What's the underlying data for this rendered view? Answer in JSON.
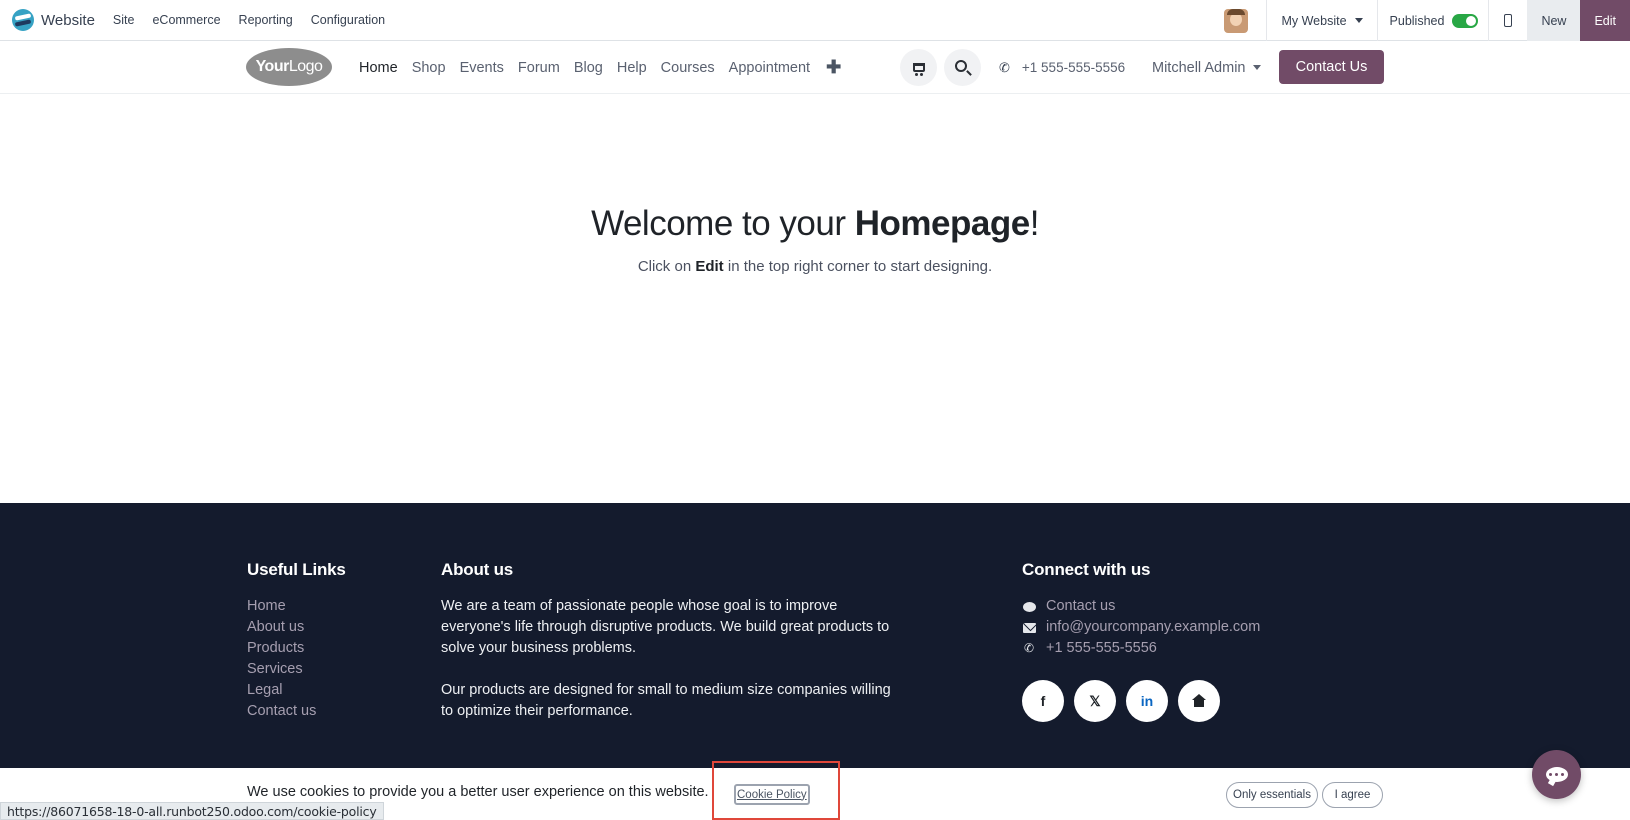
{
  "topbar": {
    "brand": "Website",
    "menu": [
      "Site",
      "eCommerce",
      "Reporting",
      "Configuration"
    ],
    "site_selector": "My Website",
    "published_label": "Published",
    "published": true,
    "new_label": "New",
    "edit_label": "Edit"
  },
  "header": {
    "logo": {
      "part1": "Your",
      "part2": "Logo"
    },
    "nav": [
      "Home",
      "Shop",
      "Events",
      "Forum",
      "Blog",
      "Help",
      "Courses",
      "Appointment"
    ],
    "active_nav": "Home",
    "phone": "+1 555-555-5556",
    "user": "Mitchell Admin",
    "contact_label": "Contact Us"
  },
  "hero": {
    "title_pre": "Welcome to your ",
    "title_bold": "Homepage",
    "title_post": "!",
    "sub_pre": "Click on ",
    "sub_bold": "Edit",
    "sub_post": " in the top right corner to start designing."
  },
  "footer": {
    "useful_links_title": "Useful Links",
    "useful_links": [
      "Home",
      "About us",
      "Products",
      "Services",
      "Legal",
      "Contact us"
    ],
    "about_title": "About us",
    "about_p1": "We are a team of passionate people whose goal is to improve everyone's life through disruptive products. We build great products to solve your business problems.",
    "about_p2": "Our products are designed for small to medium size companies willing to optimize their performance.",
    "connect_title": "Connect with us",
    "connect_contact": "Contact us",
    "connect_email": "info@yourcompany.example.com",
    "connect_phone": "+1 555-555-5556",
    "social": [
      "f",
      "𝕏",
      "in"
    ]
  },
  "cookie": {
    "text": "We use cookies to provide you a better user experience on this website.",
    "policy_link": "Cookie Policy",
    "only_essentials": "Only essentials",
    "agree": "I agree"
  },
  "status_url": "https://86071658-18-0-all.runbot250.odoo.com/cookie-policy",
  "colors": {
    "brand": "#714b67",
    "footer_bg": "#141b2d",
    "highlight": "#e0473a",
    "toggle_on": "#28a745"
  }
}
